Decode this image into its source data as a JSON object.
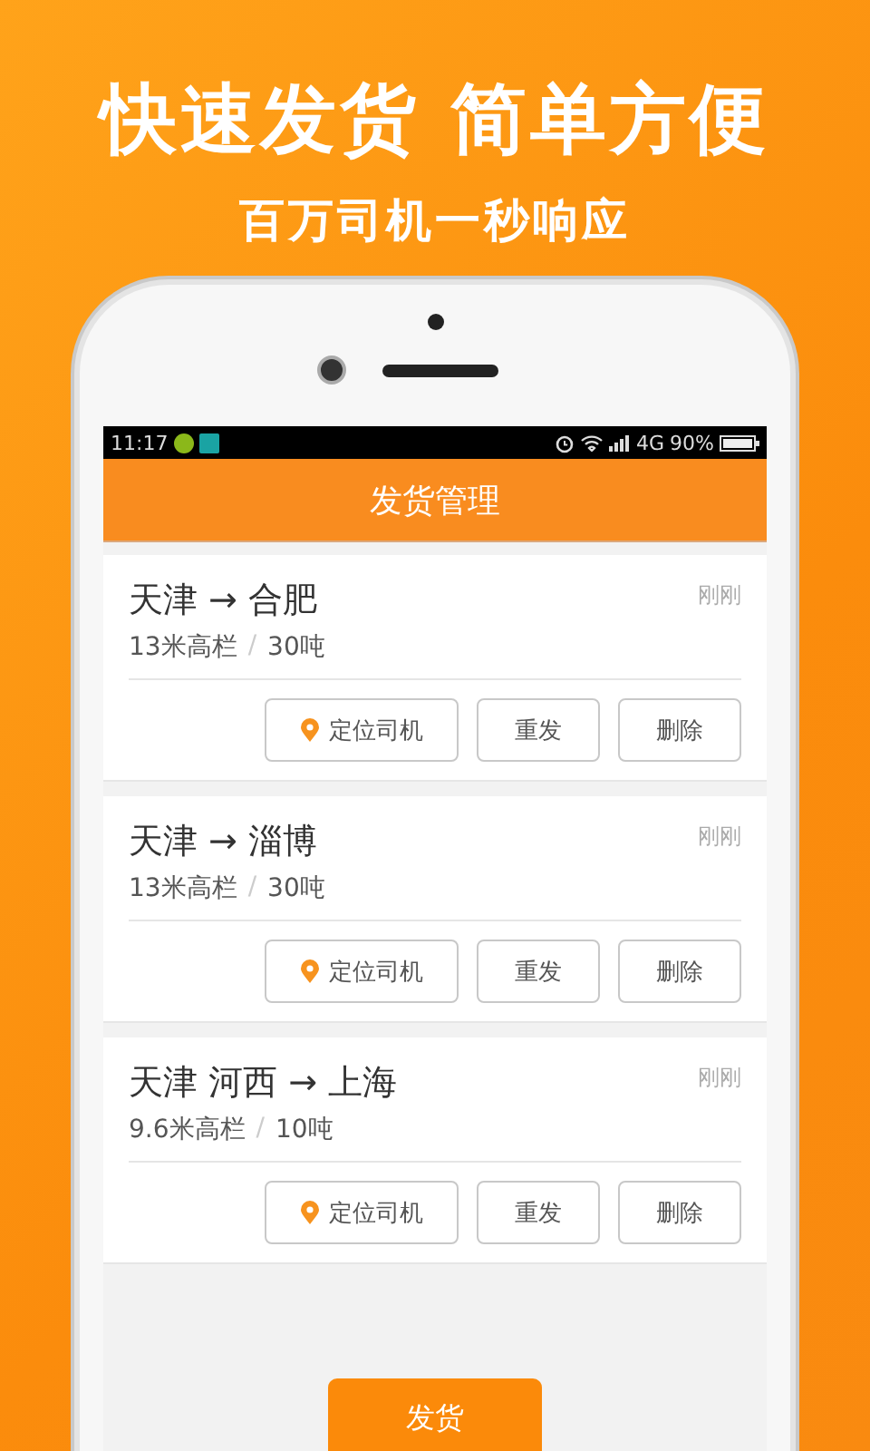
{
  "headline": "快速发货 简单方便",
  "subheadline": "百万司机一秒响应",
  "status_bar": {
    "time": "11:17",
    "network": "4G",
    "battery": "90%"
  },
  "app_bar": {
    "title": "发货管理"
  },
  "orders": [
    {
      "route": "天津 → 合肥",
      "time": "刚刚",
      "truck": "13米高栏",
      "separator": "/",
      "weight": "30吨",
      "actions": [
        {
          "kind": "locate",
          "label": "定位司机"
        },
        {
          "kind": "plain",
          "label": "重发"
        },
        {
          "kind": "plain",
          "label": "删除"
        }
      ]
    },
    {
      "route": "天津 → 淄博",
      "time": "刚刚",
      "truck": "13米高栏",
      "separator": "/",
      "weight": "30吨",
      "actions": [
        {
          "kind": "locate",
          "label": "定位司机"
        },
        {
          "kind": "plain",
          "label": "重发"
        },
        {
          "kind": "plain",
          "label": "删除"
        }
      ]
    },
    {
      "route": "天津 河西 → 上海",
      "time": "刚刚",
      "truck": "9.6米高栏",
      "separator": "/",
      "weight": "10吨",
      "actions": [
        {
          "kind": "locate",
          "label": "定位司机"
        },
        {
          "kind": "plain",
          "label": "重发"
        },
        {
          "kind": "plain",
          "label": "删除"
        }
      ]
    }
  ],
  "primary_button": "发货"
}
